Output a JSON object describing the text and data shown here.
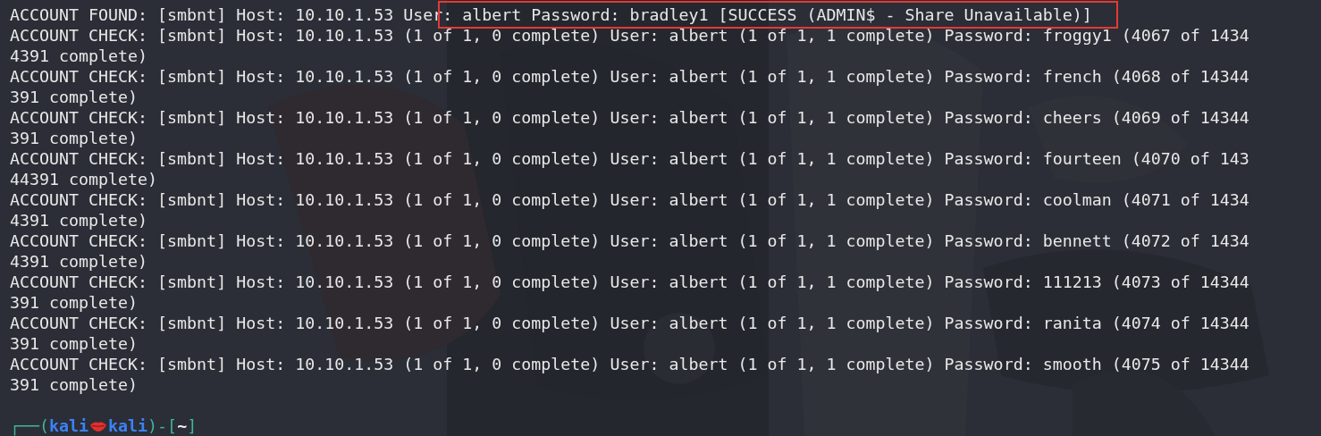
{
  "terminal": {
    "found": {
      "text": "ACCOUNT FOUND: [smbnt] Host: 10.10.1.53 User",
      "highlighted": ": albert Password: bradley1 [SUCCESS (ADMIN$ - Share Unavailable)]"
    },
    "checks": [
      "ACCOUNT CHECK: [smbnt] Host: 10.10.1.53 (1 of 1, 0 complete) User: albert (1 of 1, 1 complete) Password: froggy1 (4067 of 14344391 complete)",
      "ACCOUNT CHECK: [smbnt] Host: 10.10.1.53 (1 of 1, 0 complete) User: albert (1 of 1, 1 complete) Password: french (4068 of 14344391 complete)",
      "ACCOUNT CHECK: [smbnt] Host: 10.10.1.53 (1 of 1, 0 complete) User: albert (1 of 1, 1 complete) Password: cheers (4069 of 14344391 complete)",
      "ACCOUNT CHECK: [smbnt] Host: 10.10.1.53 (1 of 1, 0 complete) User: albert (1 of 1, 1 complete) Password: fourteen (4070 of 14344391 complete)",
      "ACCOUNT CHECK: [smbnt] Host: 10.10.1.53 (1 of 1, 0 complete) User: albert (1 of 1, 1 complete) Password: coolman (4071 of 14344391 complete)",
      "ACCOUNT CHECK: [smbnt] Host: 10.10.1.53 (1 of 1, 0 complete) User: albert (1 of 1, 1 complete) Password: bennett (4072 of 14344391 complete)",
      "ACCOUNT CHECK: [smbnt] Host: 10.10.1.53 (1 of 1, 0 complete) User: albert (1 of 1, 1 complete) Password: 111213 (4073 of 14344391 complete)",
      "ACCOUNT CHECK: [smbnt] Host: 10.10.1.53 (1 of 1, 0 complete) User: albert (1 of 1, 1 complete) Password: ranita (4074 of 14344391 complete)",
      "ACCOUNT CHECK: [smbnt] Host: 10.10.1.53 (1 of 1, 0 complete) User: albert (1 of 1, 1 complete) Password: smooth (4075 of 14344391 complete)"
    ],
    "prompt": {
      "open": "┌──(",
      "user": "kali",
      "host": "kali",
      "middle": ")-[",
      "path": "~",
      "close": "]"
    }
  }
}
